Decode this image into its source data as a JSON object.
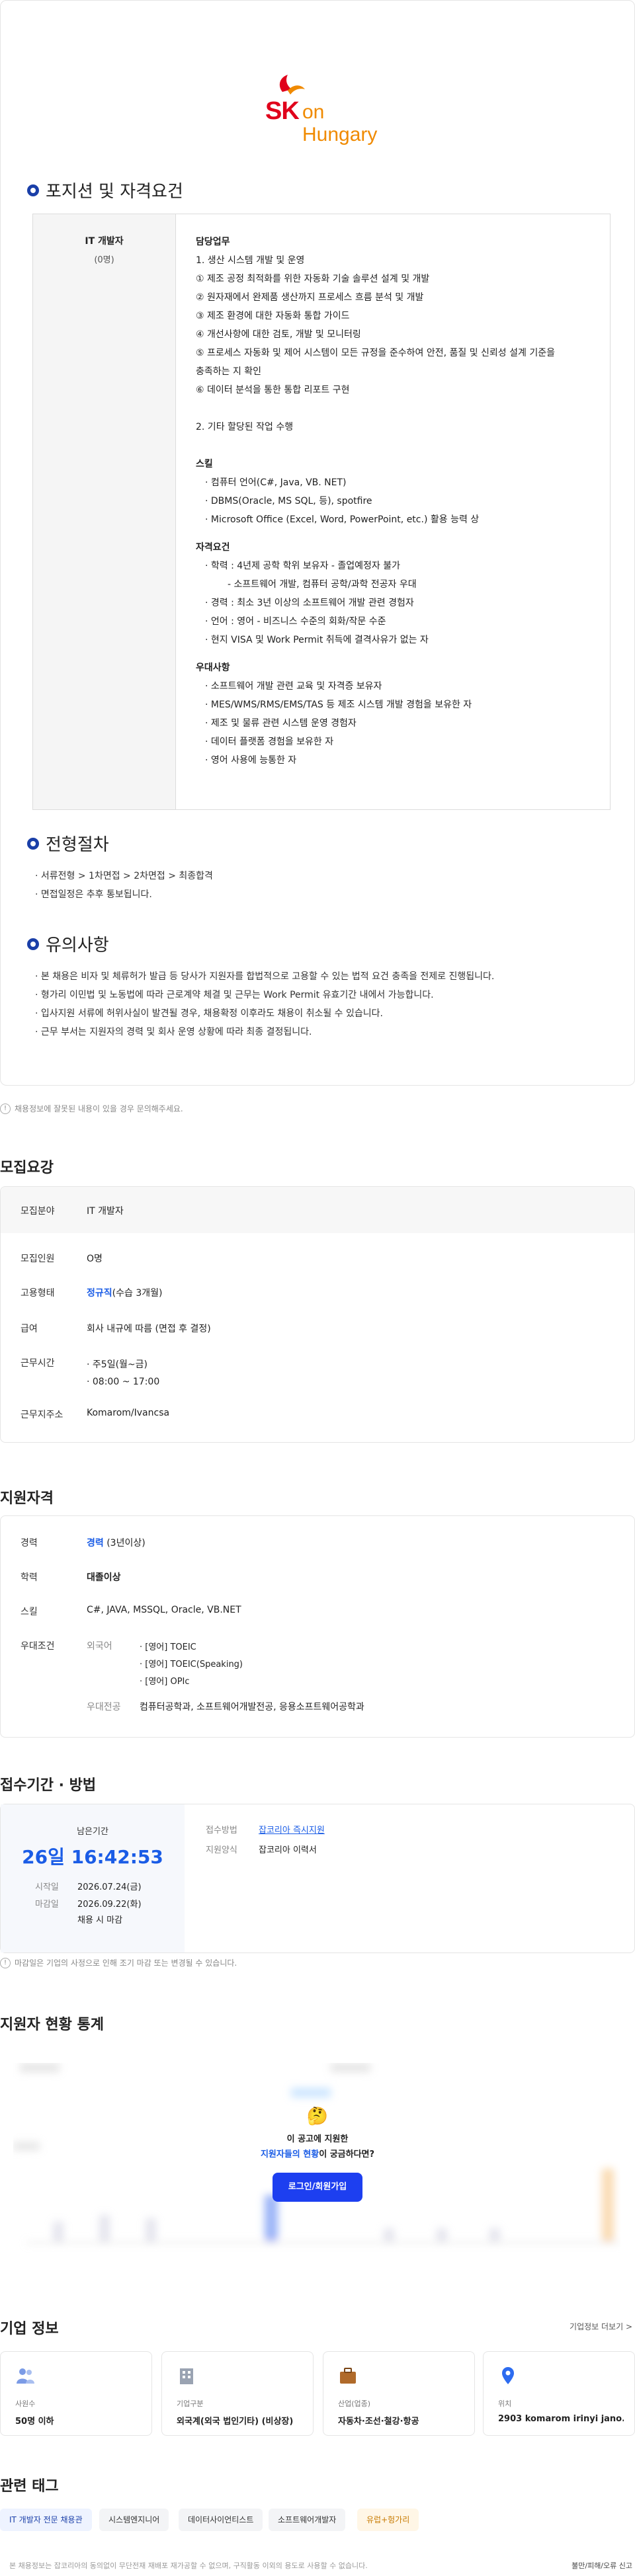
{
  "company": {
    "logo_sk": "SK",
    "logo_name": "on Hungary"
  },
  "position_section": {
    "title": "포지션 및 자격요건",
    "job_title": "IT 개발자",
    "job_count": "(0명)",
    "duties_title": "담당업무",
    "duties": [
      "1. 생산 시스템 개발 및 운영",
      "① 제조 공정 최적화를 위한 자동화 기술 솔루션 설계 및 개발",
      "② 원자재에서 완제품 생산까지 프로세스 흐름 분석 및 개발",
      "③ 제조 환경에 대한 자동화 통합 가이드",
      "④ 개선사항에 대한 검토, 개발 및 모니터링",
      "⑤ 프로세스 자동화 및 제어 시스템이 모든 규정을 준수하여 안전, 품질 및 신뢰성 설계 기준을",
      "충족하는 지 확인",
      "⑥ 데이터 분석을 통한 통합 리포트 구현"
    ],
    "duties_extra": "2. 기타 할당된 작업 수행",
    "skills_title": "스킬",
    "skills": [
      "· 컴퓨터 언어(C#, Java, VB. NET)",
      "· DBMS(Oracle, MS SQL, 등), spotfire",
      "· Microsoft Office (Excel, Word, PowerPoint, etc.) 활용 능력 상"
    ],
    "req_title": "자격요건",
    "reqs": [
      "· 학력 : 4년제 공학 학위 보유자 - 졸업예정자 불가",
      "- 소프트웨어 개발, 컴퓨터 공학/과학 전공자 우대",
      "· 경력 : 최소 3년 이상의 소프트웨어 개발 관련 경험자",
      "· 언어 : 영어 - 비즈니스 수준의 회화/작문 수준",
      "· 현지 VISA 및 Work Permit 취득에 결격사유가 없는 자"
    ],
    "pref_title": "우대사항",
    "prefs": [
      "· 소프트웨어 개발 관련 교육 및 자격증 보유자",
      "· MES/WMS/RMS/EMS/TAS 등 제조 시스템 개발 경험을 보유한 자",
      "· 제조 및 물류 관련 시스템 운영 경험자",
      "· 데이터 플랫폼 경험을 보유한 자",
      "· 영어 사용에 능통한 자"
    ]
  },
  "process_section": {
    "title": "전형절차",
    "lines": [
      "· 서류전형 > 1차면접 > 2차면접 > 최종합격",
      "· 면접일정은 추후 통보됩니다."
    ]
  },
  "notice_section": {
    "title": "유의사항",
    "lines": [
      "· 본 채용은 비자 및 체류허가 발급 등 당사가 지원자를 합법적으로 고용할 수 있는 법적 요건 충족을 전제로 진행됩니다.",
      "· 형가리 이민법 및 노동법에 따라 근로계약 체결 및 근무는 Work Permit 유효기간 내에서 가능합니다.",
      "· 입사지원 서류에 허위사실이 발견될 경우, 채용확정 이후라도 채용이 취소될 수 있습니다.",
      "· 근무 부서는 지원자의 경력 및 회사 운영 상황에 따라 최종 결정됩니다."
    ]
  },
  "card_note": "채용정보에 잘못된 내용이 있을 경우 문의해주세요.",
  "recruit": {
    "title": "모집요강",
    "rows": [
      {
        "k": "모집분야",
        "v": "IT 개발자"
      },
      {
        "k": "모집인원",
        "v": "O명"
      },
      {
        "k": "고용형태",
        "v": "정규직",
        "v2": "(수습 3개월)"
      },
      {
        "k": "급여",
        "v": "회사 내규에 따름 (면접 후 결정)"
      },
      {
        "k": "근무시간",
        "v": "· 주5일(월~금)",
        "v2": "· 08:00 ~ 17:00"
      },
      {
        "k": "근무지주소",
        "v": "Komarom/Ivancsa"
      }
    ]
  },
  "qual": {
    "title": "지원자격",
    "career_k": "경력",
    "career_v": "경력",
    "career_v2": "(3년이상)",
    "edu_k": "학력",
    "edu_v": "대졸이상",
    "skill_k": "스킬",
    "skill_v": "C#, JAVA, MSSQL, Oracle, VB.NET",
    "pref_k": "우대조건",
    "lang_k": "외국어",
    "langs": [
      "· [영어] TOEIC",
      "· [영어] TOEIC(Speaking)",
      "· [영어] OPIc"
    ],
    "major_k": "우대전공",
    "major_v": "컴퓨터공학과, 소프트웨어개발전공, 응용소프트웨어공학과"
  },
  "deadline": {
    "title": "접수기간 · 방법",
    "remain_label": "남은기간",
    "remain_value": "26일 16:42:53",
    "start_k": "시작일",
    "start_v": "2026.07.24(금)",
    "end_k": "마감일",
    "end_v": "2026.09.22(화)",
    "end_note": "채용 시 마감",
    "method_k": "접수방법",
    "method_v": "잡코리아 즉시지원",
    "form_k": "지원양식",
    "form_v": "잡코리아 이력서",
    "note": "마감일은 기업의 사정으로 인해 조기 마감 또는 변경될 수 있습니다."
  },
  "stats": {
    "title": "지원자 현황 통계",
    "q1": "이 공고에 지원한",
    "q2_blue": "지원자들의 현황",
    "q2_rest": "이 궁금하다면?",
    "login": "로그인/회원가입"
  },
  "company_info": {
    "title": "기업 정보",
    "more": "기업정보 더보기 >",
    "items": [
      {
        "label": "사원수",
        "value": "50명 이하",
        "icon": "people-icon",
        "color": "#7b9be6"
      },
      {
        "label": "기업구분",
        "value": "외국계(외국 법인기타) (비상장)",
        "icon": "building-icon",
        "color": "#9aa3b2"
      },
      {
        "label": "산업(업종)",
        "value": "자동차·조선·철강·항공",
        "icon": "briefcase-icon",
        "color": "#b06a2a"
      },
      {
        "label": "위치",
        "value": "2903 komarom irinyi jano...",
        "icon": "map-pin-icon",
        "color": "#2d6cf0"
      }
    ]
  },
  "tags": {
    "title": "관련 태그",
    "items": [
      "IT 개발자 전문 채용관",
      "시스템엔지니어",
      "데이터사이언티스트",
      "소프트웨어개발자",
      "유럽+헝가리"
    ]
  },
  "footer": {
    "text": "본 채용정보는 잡코리아의 동의없이 무단전재 재배포 재가공할 수 없으며, 구직활동 이외의 용도로 사용할 수 없습니다.",
    "right": "불만/피해/오류 신고"
  }
}
